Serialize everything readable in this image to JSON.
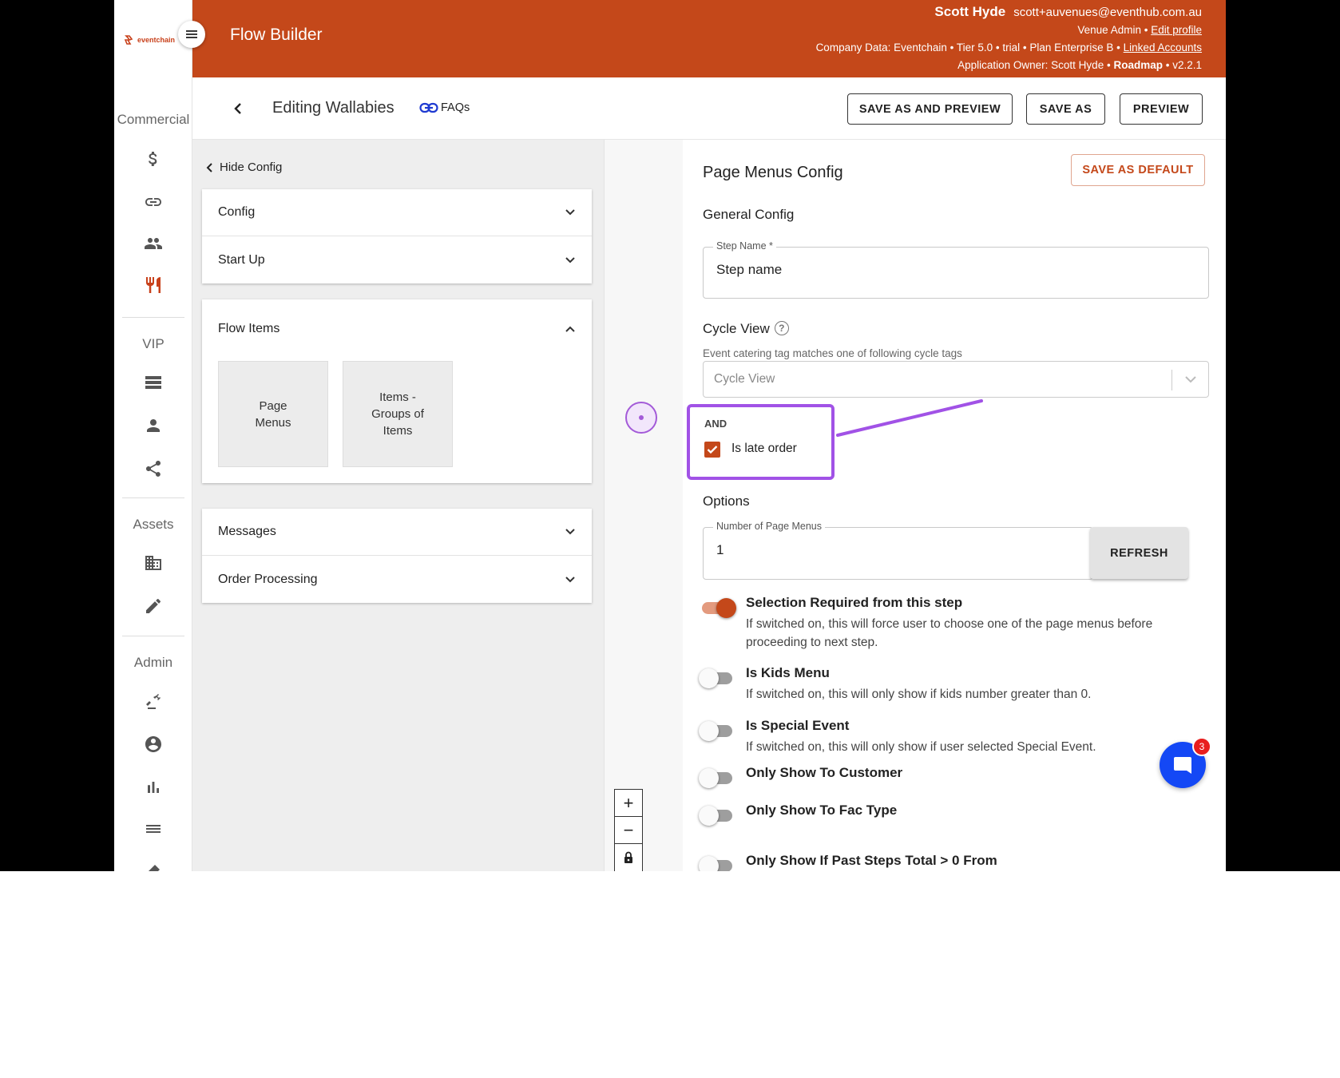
{
  "logo": {
    "text": "eventchain"
  },
  "header": {
    "title": "Flow Builder",
    "user_name": "Scott Hyde",
    "user_email": "scott+auvenues@eventhub.com.au",
    "role_text": "Venue Admin •",
    "edit_profile": "Edit profile",
    "company_text": "Company Data: Eventchain • Tier 5.0 • trial • Plan Enterprise B •",
    "linked_accounts": "Linked Accounts",
    "owner_text": "Application Owner: Scott Hyde •",
    "roadmap": "Roadmap",
    "version": "• v2.2.1"
  },
  "sidebar": {
    "sections": [
      "Commercial",
      "VIP",
      "Assets",
      "Admin"
    ],
    "icons": [
      "dollar-icon",
      "link-icon",
      "people-icon",
      "restaurant-icon",
      "storage-icon",
      "person-icon",
      "share-icon",
      "building-icon",
      "pencil-icon",
      "admin-tool-icon",
      "account-icon",
      "bar-chart-icon",
      "list-icon"
    ]
  },
  "toolbar": {
    "editing_title": "Editing Wallabies",
    "faqs": "FAQs",
    "save_as_preview": "SAVE AS AND PREVIEW",
    "save_as": "SAVE AS",
    "preview": "PREVIEW"
  },
  "config_panel": {
    "hide_config": "Hide Config",
    "group1": [
      "Config",
      "Start Up"
    ],
    "flow_items_title": "Flow Items",
    "flow_tiles": [
      "Page Menus",
      "Items - Groups of Items"
    ],
    "group3": [
      "Messages",
      "Order Processing"
    ]
  },
  "page_menus_config": {
    "title": "Page Menus Config",
    "save_default": "SAVE AS DEFAULT",
    "general_config": "General Config",
    "step_name_label": "Step Name *",
    "step_name_value": "Step name",
    "cycle_view_title": "Cycle View",
    "cycle_hint": "Event catering tag matches one of following cycle tags",
    "cycle_placeholder": "Cycle View",
    "and_label": "AND",
    "late_order_label": "Is late order",
    "late_order_checked": true,
    "options_title": "Options",
    "num_page_menus_label": "Number of Page Menus",
    "num_page_menus_value": "1",
    "refresh": "REFRESH",
    "toggles": [
      {
        "title": "Selection Required from this step",
        "desc": "If switched on, this will force user to choose one of the page menus before proceeding to next step.",
        "on": true
      },
      {
        "title": "Is Kids Menu",
        "desc": "If switched on, this will only show if kids number greater than 0.",
        "on": false
      },
      {
        "title": "Is Special Event",
        "desc": "If switched on, this will only show if user selected Special Event.",
        "on": false
      },
      {
        "title": "Only Show To Customer",
        "desc": "",
        "on": false
      },
      {
        "title": "Only Show To Fac Type",
        "desc": "",
        "on": false
      },
      {
        "title": "Only Show If Past Steps Total > 0 From",
        "desc": "",
        "on": false
      }
    ]
  },
  "zoom": {
    "in": "+",
    "out": "−"
  },
  "chat": {
    "badge": "3"
  },
  "colors": {
    "brand": "#c4481a",
    "annotation": "#a152e6",
    "chat": "#1448f5"
  }
}
